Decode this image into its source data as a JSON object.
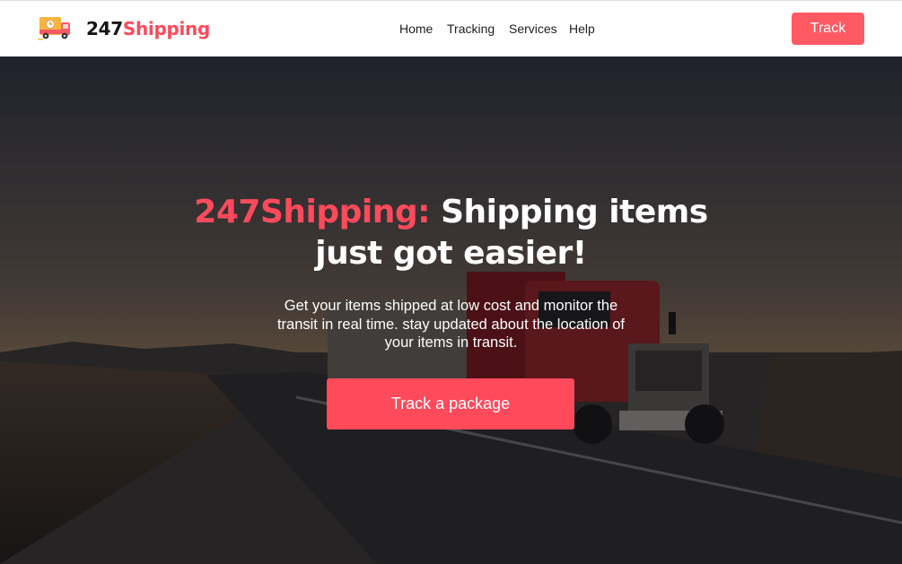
{
  "brand": {
    "name_part1": "247",
    "name_part2": "Shipping",
    "logo_icon": "delivery-truck-clock-icon"
  },
  "nav": {
    "items": [
      "Home",
      "Tracking",
      "Services",
      "Help"
    ],
    "track_button": "Track"
  },
  "hero": {
    "background": "red-semi-truck-on-highway-at-sunset",
    "headline_accent": "247Shipping:",
    "headline_line1_rest": "Shipping items",
    "headline_line2": "just got easier!",
    "subtext": "Get your items shipped at low cost and monitor the transit in real time. stay updated about the location of your items in transit.",
    "cta_label": "Track a package"
  },
  "colors": {
    "accent": "#ff4a5c",
    "nav_button": "#ff5a64",
    "text_dark": "#1e1e1e"
  }
}
